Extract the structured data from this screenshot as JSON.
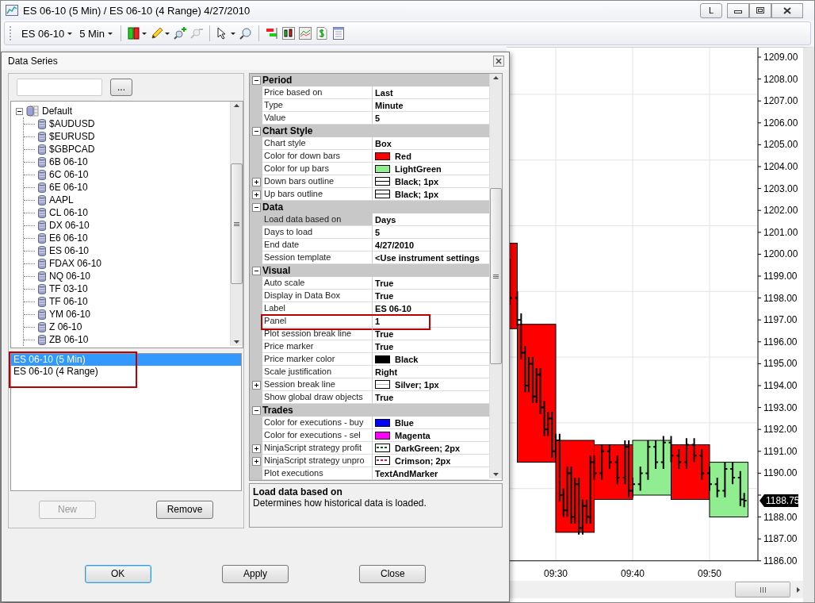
{
  "window": {
    "title": "ES 06-10 (5 Min) / ES 06-10 (4 Range)  4/27/2010",
    "buttons": [
      {
        "kind": "text",
        "label": "L"
      },
      {
        "kind": "minimize"
      },
      {
        "kind": "maximize"
      },
      {
        "kind": "close"
      }
    ]
  },
  "toolbar": {
    "instrument": "ES 06-10",
    "interval": "5 Min"
  },
  "dialog": {
    "title": "Data Series",
    "browse_button": "...",
    "tree": {
      "label": "Default",
      "expanded": true,
      "children": [
        {
          "label": "$AUDUSD"
        },
        {
          "label": "$EURUSD"
        },
        {
          "label": "$GBPCAD"
        },
        {
          "label": "6B 06-10"
        },
        {
          "label": "6C 06-10"
        },
        {
          "label": "6E 06-10"
        },
        {
          "label": "AAPL"
        },
        {
          "label": "CL 06-10"
        },
        {
          "label": "DX 06-10"
        },
        {
          "label": "E6 06-10"
        },
        {
          "label": "ES 06-10"
        },
        {
          "label": "FDAX 06-10"
        },
        {
          "label": "NQ 06-10"
        },
        {
          "label": "TF 03-10"
        },
        {
          "label": "TF 06-10"
        },
        {
          "label": "YM 06-10"
        },
        {
          "label": "Z 06-10"
        },
        {
          "label": "ZB 06-10"
        }
      ]
    },
    "series_list": {
      "highlighted": true,
      "items": [
        {
          "label": "ES 06-10 (5 Min)",
          "selected": true
        },
        {
          "label": "ES 06-10 (4 Range)",
          "selected": false
        }
      ]
    },
    "left_buttons": [
      {
        "label": "New",
        "disabled": true
      },
      {
        "label": "Remove",
        "disabled": false
      }
    ],
    "properties": [
      {
        "category": "Period",
        "expanded": true,
        "rows": [
          {
            "name": "Price based on",
            "value": "Last",
            "selected": false
          },
          {
            "name": "Type",
            "value": "Minute",
            "selected": false
          },
          {
            "name": "Value",
            "value": "5",
            "selected": false
          }
        ]
      },
      {
        "category": "Chart Style",
        "expanded": true,
        "rows": [
          {
            "name": "Chart style",
            "value": "Box",
            "selected": false
          },
          {
            "name": "Color for down bars",
            "value": "Red",
            "selected": false,
            "swatch": {
              "kind": "fill",
              "color": "#ff0000"
            }
          },
          {
            "name": "Color for up bars",
            "value": "LightGreen",
            "selected": false,
            "swatch": {
              "kind": "fill",
              "color": "#90ee90"
            }
          },
          {
            "name": "Down bars outline",
            "value": "Black; 1px",
            "selected": false,
            "expandable": true,
            "swatch": {
              "kind": "line",
              "color": "#000000"
            }
          },
          {
            "name": "Up bars outline",
            "value": "Black; 1px",
            "selected": false,
            "expandable": true,
            "swatch": {
              "kind": "line",
              "color": "#000000"
            }
          }
        ]
      },
      {
        "category": "Data",
        "expanded": true,
        "rows": [
          {
            "name": "Load data based on",
            "value": "Days",
            "selected": true
          },
          {
            "name": "Days to load",
            "value": "5",
            "selected": false
          },
          {
            "name": "End date",
            "value": "4/27/2010",
            "selected": false
          },
          {
            "name": "Session template",
            "value": "<Use instrument settings",
            "selected": false
          }
        ]
      },
      {
        "category": "Visual",
        "expanded": true,
        "rows": [
          {
            "name": "Auto scale",
            "value": "True",
            "selected": false
          },
          {
            "name": "Display in Data Box",
            "value": "True",
            "selected": false
          },
          {
            "name": "Label",
            "value": "ES 06-10",
            "selected": false
          },
          {
            "name": "Panel",
            "value": "1",
            "selected": false,
            "highlighted": true
          },
          {
            "name": "Plot session break line",
            "value": "True",
            "selected": false
          },
          {
            "name": "Price marker",
            "value": "True",
            "selected": false
          },
          {
            "name": "Price marker color",
            "value": "Black",
            "selected": false,
            "swatch": {
              "kind": "fill",
              "color": "#000000"
            }
          },
          {
            "name": "Scale justification",
            "value": "Right",
            "selected": false
          },
          {
            "name": "Session break line",
            "value": "Silver; 1px",
            "selected": false,
            "expandable": true,
            "swatch": {
              "kind": "line",
              "color": "#c0c0c0"
            }
          },
          {
            "name": "Show global draw objects",
            "value": "True",
            "selected": false
          }
        ]
      },
      {
        "category": "Trades",
        "expanded": true,
        "rows": [
          {
            "name": "Color for executions - buy",
            "value": "Blue",
            "selected": false,
            "swatch": {
              "kind": "fill",
              "color": "#0000ff"
            }
          },
          {
            "name": "Color for executions - sel",
            "value": "Magenta",
            "selected": false,
            "swatch": {
              "kind": "fill",
              "color": "#ff00ff"
            }
          },
          {
            "name": "NinjaScript strategy profit",
            "value": "DarkGreen; 2px",
            "selected": false,
            "expandable": true,
            "swatch": {
              "kind": "dotted",
              "color": "#006400"
            }
          },
          {
            "name": "NinjaScript strategy unpro",
            "value": "Crimson; 2px",
            "selected": false,
            "expandable": true,
            "swatch": {
              "kind": "dotted",
              "color": "#dc143c"
            }
          },
          {
            "name": "Plot executions",
            "value": "TextAndMarker",
            "selected": false
          }
        ]
      }
    ],
    "description": {
      "title": "Load data based on",
      "text": "Determines how historical data is loaded."
    },
    "buttons": [
      {
        "label": "OK",
        "default": true
      },
      {
        "label": "Apply",
        "default": false
      },
      {
        "label": "Close",
        "default": false
      }
    ]
  },
  "chart": {
    "y_labels": [
      "1209.00",
      "1208.00",
      "1207.00",
      "1206.00",
      "1205.00",
      "1204.00",
      "1203.00",
      "1202.00",
      "1201.00",
      "1200.00",
      "1199.00",
      "1198.00",
      "1197.00",
      "1196.00",
      "1195.00",
      "1194.00",
      "1193.00",
      "1192.00",
      "1191.00",
      "1190.00"
    ],
    "y_labels_below_marker": [
      "1188.00",
      "1187.00",
      "1186.00"
    ],
    "x_labels": [
      "09:30",
      "09:40",
      "09:50"
    ],
    "price_marker": "1188.75"
  }
}
